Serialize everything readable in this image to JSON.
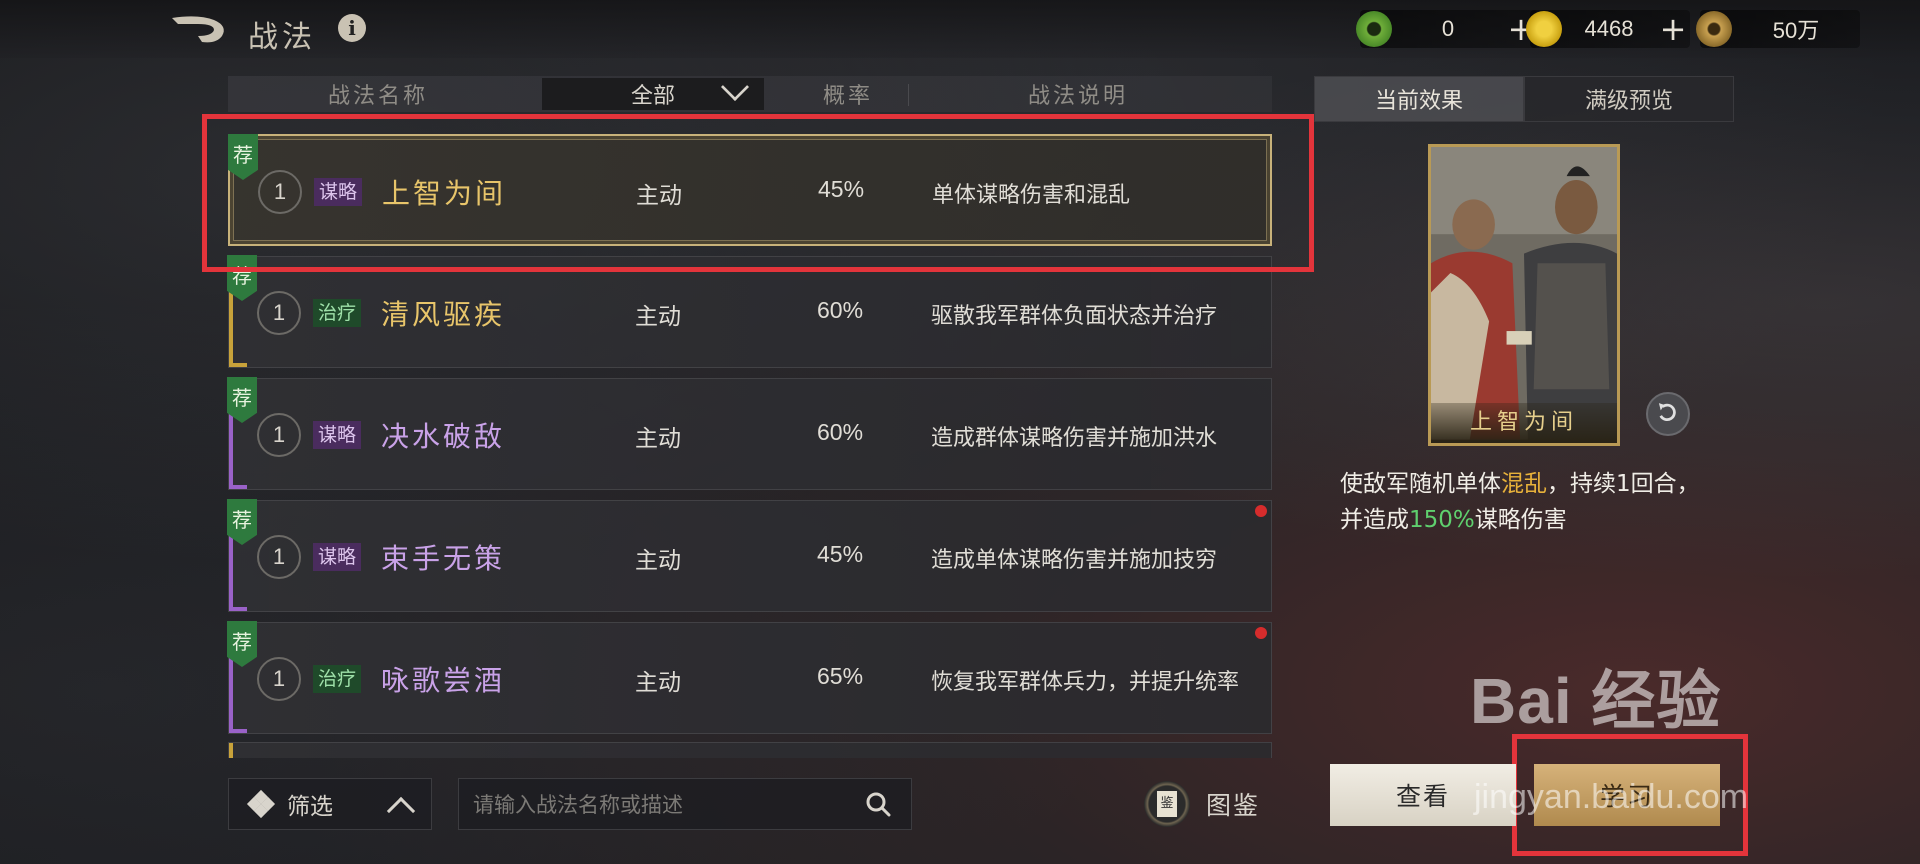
{
  "header": {
    "title": "战法"
  },
  "resources": [
    {
      "value": "0",
      "color": "#6fae3a"
    },
    {
      "value": "4468",
      "color": "#d8b820"
    },
    {
      "value": "50万",
      "color": "#b8924a"
    }
  ],
  "table": {
    "columns": {
      "name": "战法名称",
      "filter": "全部",
      "rate": "概率",
      "desc": "战法说明"
    },
    "rows": [
      {
        "rec": "荐",
        "level": "1",
        "tag": "谋略",
        "name": "上智为间",
        "type": "主动",
        "rate": "45%",
        "desc": "单体谋略伤害和混乱"
      },
      {
        "rec": "荐",
        "level": "1",
        "tag": "治疗",
        "name": "清风驱疾",
        "type": "主动",
        "rate": "60%",
        "desc": "驱散我军群体负面状态并治疗"
      },
      {
        "rec": "荐",
        "level": "1",
        "tag": "谋略",
        "name": "决水破敌",
        "type": "主动",
        "rate": "60%",
        "desc": "造成群体谋略伤害并施加洪水"
      },
      {
        "rec": "荐",
        "level": "1",
        "tag": "谋略",
        "name": "束手无策",
        "type": "主动",
        "rate": "45%",
        "desc": "造成单体谋略伤害并施加技穷"
      },
      {
        "rec": "荐",
        "level": "1",
        "tag": "治疗",
        "name": "咏歌尝酒",
        "type": "主动",
        "rate": "65%",
        "desc": "恢复我军群体兵力，并提升统率"
      }
    ]
  },
  "bottom": {
    "filter_label": "筛选",
    "search_placeholder": "请输入战法名称或描述",
    "tujian_icon_char": "鉴",
    "tujian_label": "图鉴"
  },
  "panel": {
    "tabs": [
      "当前效果",
      "满级预览"
    ],
    "card_name": "上智为间",
    "effect": {
      "p1": "使敌军随机单体",
      "hl1": "混乱",
      "p2": "，持续1回合，并造成",
      "hl2": "150%",
      "p3": "谋略伤害"
    },
    "view_button": "查看",
    "learn_button": "学习"
  },
  "watermark": {
    "main": "Bai 经验",
    "sub": "jingyan.baidu.com"
  }
}
